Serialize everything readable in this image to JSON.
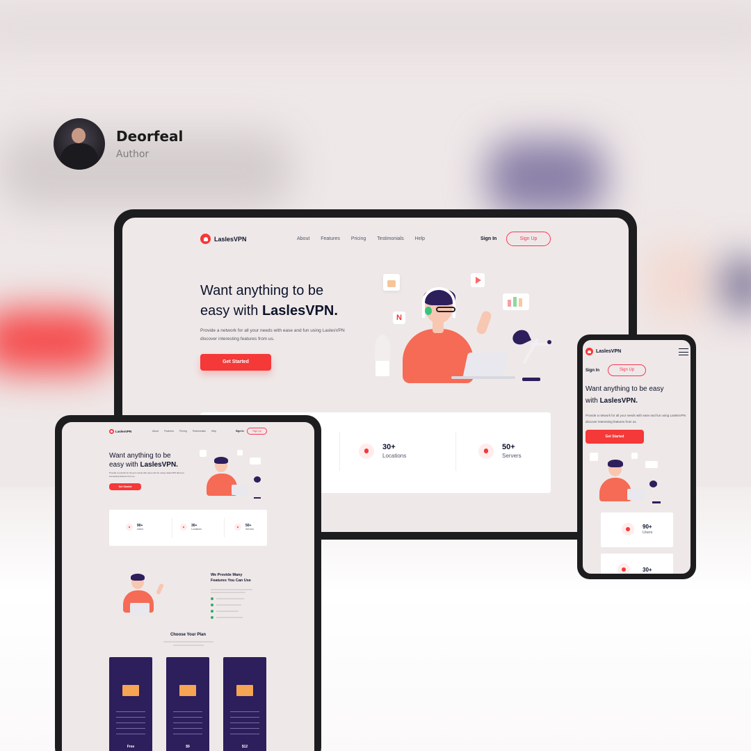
{
  "author": {
    "name": "Deorfeal",
    "role": "Author"
  },
  "brand": {
    "name": "LaslesVPN",
    "accent": "#f53838",
    "accent_soft": "#ffecec",
    "dark": "#0b132a",
    "purple": "#2d1e5c"
  },
  "nav": {
    "links": [
      "About",
      "Features",
      "Pricing",
      "Testimonials",
      "Help"
    ],
    "sign_in": "Sign In",
    "sign_up": "Sign Up"
  },
  "hero": {
    "title_line1": "Want anything to be",
    "title_line2_prefix": "easy with ",
    "title_brand": "LaslesVPN.",
    "description": "Provide a network for all your needs with ease and fun using LaslesVPN discover interesting features from us.",
    "cta": "Get Started"
  },
  "phone_hero": {
    "title_line1": "Want anything to be easy",
    "title_line2_prefix": "with ",
    "title_brand": "LaslesVPN."
  },
  "stats": [
    {
      "value": "90+",
      "label": "Users",
      "icon": "user-icon"
    },
    {
      "value": "30+",
      "label": "Locations",
      "icon": "location-pin-icon"
    },
    {
      "value": "50+",
      "label": "Servers",
      "icon": "server-icon"
    }
  ],
  "features": {
    "title_line1": "We Provide Many",
    "title_line2": "Features You Can Use"
  },
  "plans": {
    "title": "Choose Your Plan",
    "prices": [
      "Free",
      "$9",
      "$12"
    ]
  }
}
